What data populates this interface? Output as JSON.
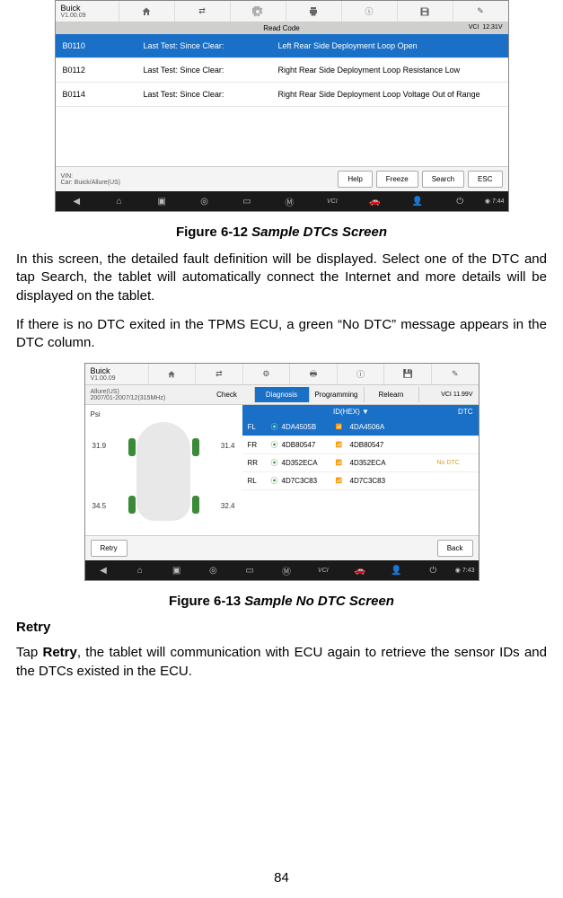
{
  "screenshot1": {
    "brand": "Buick",
    "version": "V1.00.09",
    "subheader": "Read Code",
    "vci": "VCI",
    "battery": "12.31V",
    "rows": [
      {
        "code": "B0110",
        "status": "Last Test: Since Clear:",
        "desc": "Left Rear Side Deployment Loop Open"
      },
      {
        "code": "B0112",
        "status": "Last Test: Since Clear:",
        "desc": "Right Rear Side Deployment Loop Resistance Low"
      },
      {
        "code": "B0114",
        "status": "Last Test: Since Clear:",
        "desc": "Right Rear Side Deployment Loop Voltage Out of Range"
      }
    ],
    "vin_label": "VIN:",
    "vin_car": "Car: Buick/Allure(US)",
    "btn_help": "Help",
    "btn_freeze": "Freeze",
    "btn_search": "Search",
    "btn_esc": "ESC",
    "time": "7:44"
  },
  "caption1_prefix": "Figure 6-12 ",
  "caption1_title": "Sample DTCs Screen",
  "para1": "In this screen, the detailed fault definition will be displayed. Select one of the DTC and tap Search, the tablet will automatically connect the Internet and more details will be displayed on the tablet.",
  "para2": "If there is no DTC exited in the TPMS ECU, a green “No DTC” message appears in the DTC column.",
  "screenshot2": {
    "brand": "Buick",
    "version": "V1.00.09",
    "vehicle": "Allure(US)\n2007/01-2007/12(315MHz)",
    "vci": "VCI",
    "battery": "11.99V",
    "tabs": [
      "Check",
      "Diagnosis",
      "Programming",
      "Relearn"
    ],
    "active_tab": 1,
    "psi": "Psi",
    "pressures": {
      "fl": "31.9",
      "fr": "31.4",
      "rl": "34.5",
      "rr": "32.4"
    },
    "col_id": "ID(HEX) ▼",
    "col_dtc": "DTC",
    "rows": [
      {
        "pos": "FL",
        "id1": "4DA4505B",
        "id2": "4DA4506A"
      },
      {
        "pos": "FR",
        "id1": "4DB80547",
        "id2": "4DB80547"
      },
      {
        "pos": "RR",
        "id1": "4D352ECA",
        "id2": "4D352ECA"
      },
      {
        "pos": "RL",
        "id1": "4D7C3C83",
        "id2": "4D7C3C83"
      }
    ],
    "no_dtc": "No DTC",
    "btn_retry": "Retry",
    "btn_back": "Back",
    "time": "7:43"
  },
  "caption2_prefix": "Figure 6-13 ",
  "caption2_title": "Sample No DTC Screen",
  "heading_retry": "Retry",
  "para3_a": "Tap ",
  "para3_b": "Retry",
  "para3_c": ", the tablet will communication with ECU again to retrieve the sensor IDs and the DTCs existed in the ECU.",
  "page_number": "84"
}
